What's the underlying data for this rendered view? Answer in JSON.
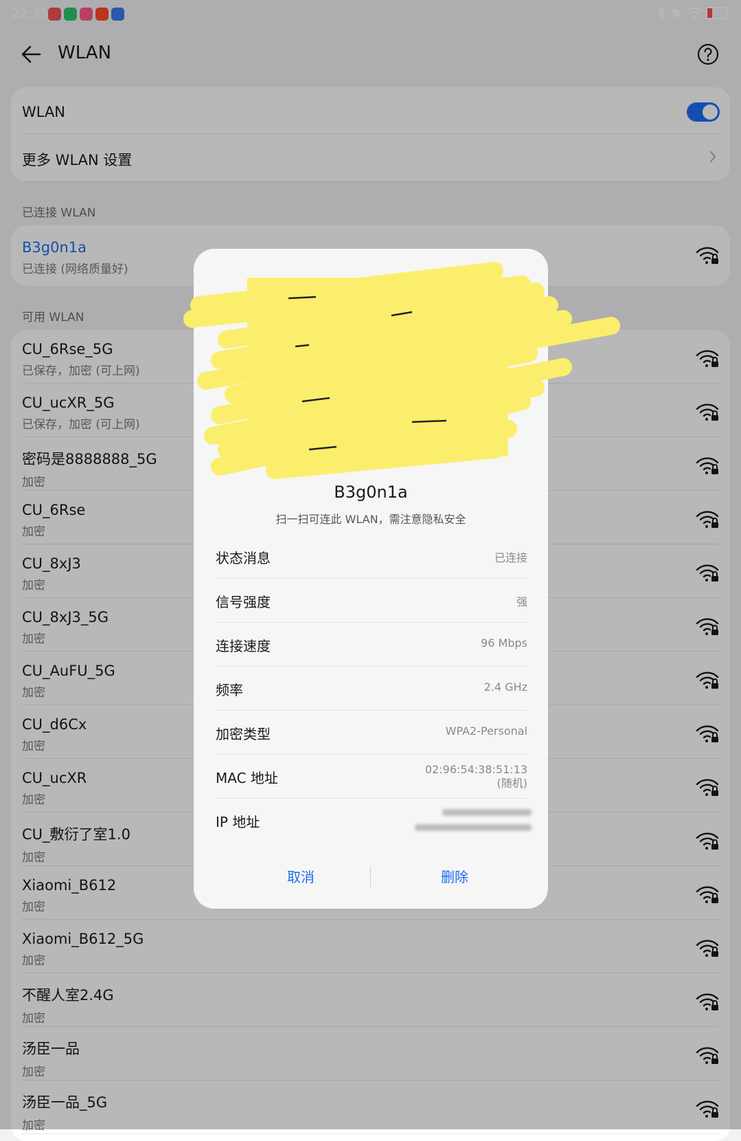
{
  "status_bar": {
    "time": "22:35",
    "more": "···",
    "battery": "6",
    "app_icons": [
      {
        "name": "app-icon-red",
        "color": "#f05454"
      },
      {
        "name": "wechat-icon",
        "color": "#2dc76d"
      },
      {
        "name": "app-icon-pink",
        "color": "#ff5a8a"
      },
      {
        "name": "app-icon-orange",
        "color": "#ff4a2a"
      },
      {
        "name": "app-icon-blue",
        "color": "#3a7bf4"
      }
    ]
  },
  "header": {
    "title": "WLAN"
  },
  "wlan_card": {
    "toggle_label": "WLAN",
    "toggle_on": true,
    "more_settings": "更多 WLAN 设置"
  },
  "connected_section": {
    "label": "已连接 WLAN",
    "network": {
      "name": "B3g0n1a",
      "status": "已连接 (网络质量好)"
    }
  },
  "available_section": {
    "label": "可用 WLAN",
    "networks": [
      {
        "name": "CU_6Rse_5G",
        "status": "已保存，加密 (可上网)"
      },
      {
        "name": "CU_ucXR_5G",
        "status": "已保存，加密 (可上网)"
      },
      {
        "name": "密码是8888888_5G",
        "status": "加密"
      },
      {
        "name": "CU_6Rse",
        "status": "加密"
      },
      {
        "name": "CU_8xJ3",
        "status": "加密"
      },
      {
        "name": "CU_8xJ3_5G",
        "status": "加密"
      },
      {
        "name": "CU_AuFU_5G",
        "status": "加密"
      },
      {
        "name": "CU_d6Cx",
        "status": "加密"
      },
      {
        "name": "CU_ucXR",
        "status": "加密"
      },
      {
        "name": "CU_敷衍了室1.0",
        "status": "加密"
      },
      {
        "name": "Xiaomi_B612",
        "status": "加密"
      },
      {
        "name": "Xiaomi_B612_5G",
        "status": "加密"
      },
      {
        "name": "不醒人室2.4G",
        "status": "加密"
      },
      {
        "name": "汤臣一品",
        "status": "加密"
      },
      {
        "name": "汤臣一品_5G",
        "status": "加密"
      }
    ]
  },
  "dialog": {
    "network_name": "B3g0n1a",
    "hint": "扫一扫可连此 WLAN，需注意隐私安全",
    "rows": [
      {
        "label": "状态消息",
        "value": "已连接"
      },
      {
        "label": "信号强度",
        "value": "强"
      },
      {
        "label": "连接速度",
        "value": "96 Mbps"
      },
      {
        "label": "频率",
        "value": "2.4 GHz"
      },
      {
        "label": "加密类型",
        "value": "WPA2-Personal"
      }
    ],
    "mac": {
      "label": "MAC 地址",
      "value": "02:96:54:38:51:13",
      "note": "(随机)"
    },
    "ip": {
      "label": "IP 地址"
    },
    "cancel": "取消",
    "delete": "删除"
  },
  "colors": {
    "accent": "#1f6cf0",
    "scribble": "#fbee6c"
  }
}
